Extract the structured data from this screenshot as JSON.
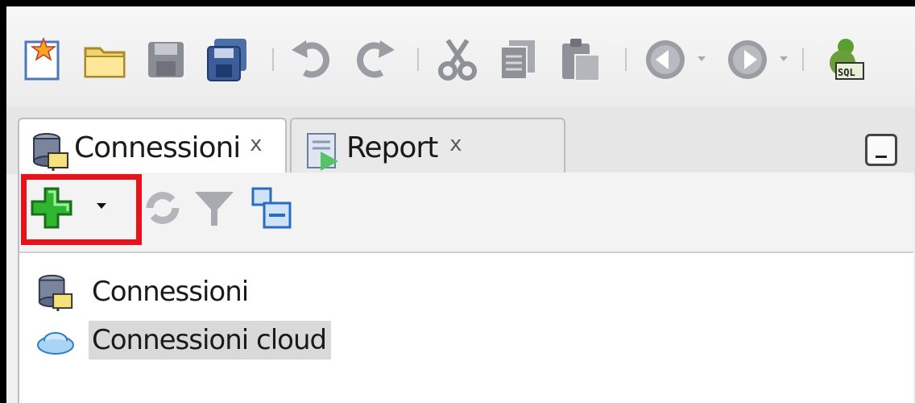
{
  "toolbar": {
    "icons": [
      "new-file-icon",
      "open-folder-icon",
      "save-icon",
      "save-all-icon",
      "undo-icon",
      "redo-icon",
      "cut-icon",
      "copy-icon",
      "paste-icon",
      "back-icon",
      "forward-icon",
      "sql-worksheet-icon"
    ]
  },
  "tabs": [
    {
      "label": "Connessioni",
      "close": "x",
      "active": true
    },
    {
      "label": "Report",
      "close": "x",
      "active": false
    }
  ],
  "panel_toolbar": {
    "icons": [
      "add-connection-icon",
      "dropdown-arrow-icon",
      "refresh-icon",
      "filter-icon",
      "schema-browser-icon"
    ]
  },
  "tree": [
    {
      "label": "Connessioni",
      "icon": "database-connections-icon",
      "selected": false
    },
    {
      "label": "Connessioni cloud",
      "icon": "cloud-icon",
      "selected": true
    }
  ],
  "colors": {
    "highlight": "#e8121b",
    "selection": "#d9d9d9",
    "add_green": "#2fb52f"
  }
}
